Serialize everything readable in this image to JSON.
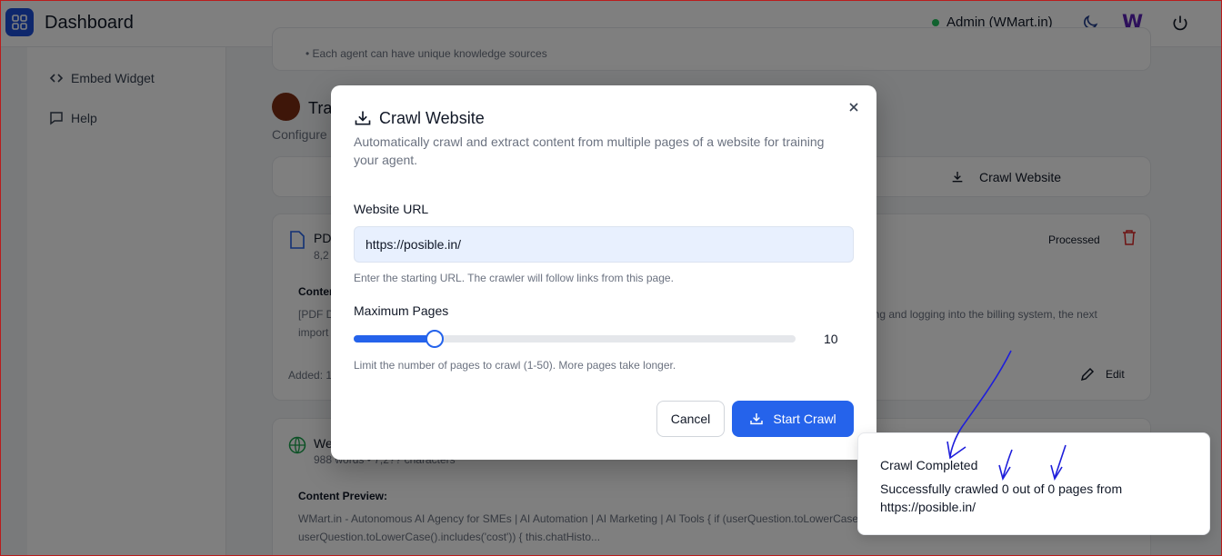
{
  "app": {
    "title": "Dashboard",
    "user": "Admin (WMart.in)",
    "brand_letter": "W"
  },
  "sidebar": {
    "items": [
      {
        "label": "Embed Widget"
      },
      {
        "label": "Help"
      }
    ]
  },
  "background": {
    "tip_text": "• Each agent can have unique knowledge sources",
    "section_title_partial": "Tra",
    "section_sub_partial": "Configure",
    "crawl_tab_label": "Crawl Website",
    "doc1": {
      "title_partial": "PD",
      "meta_partial": "8,2",
      "status": "Processed",
      "content_label_partial": "Conten",
      "preview_partial_left": "[PDF D",
      "preview_partial_left2": "import",
      "preview_right": "ing and logging into the billing system, the next",
      "added_partial": "Added: 1",
      "edit_label": "Edit"
    },
    "doc2": {
      "title_partial": "We",
      "meta_partial": "988 words • 7,2?? characters",
      "content_label": "Content Preview:",
      "preview_line1": "WMart.in - Autonomous AI Agency for SMEs | AI Automation | AI Marketing | AI Tools { if (userQuestion.toLowerCase",
      "preview_line2": "userQuestion.toLowerCase().includes('cost')) { this.chatHisto..."
    }
  },
  "modal": {
    "title": "Crawl Website",
    "description": "Automatically crawl and extract content from multiple pages of a website for training your agent.",
    "url_label": "Website URL",
    "url_value": "https://posible.in/",
    "url_hint": "Enter the starting URL. The crawler will follow links from this page.",
    "max_pages_label": "Maximum Pages",
    "max_pages_value": "10",
    "max_pages_min": 1,
    "max_pages_max": 50,
    "max_pages_hint": "Limit the number of pages to crawl (1-50). More pages take longer.",
    "cancel_label": "Cancel",
    "start_label": "Start Crawl"
  },
  "toast": {
    "title": "Crawl Completed",
    "message": "Successfully crawled 0 out of 0 pages from https://posible.in/"
  },
  "colors": {
    "primary": "#2563eb",
    "brand_purple": "#5b21b6",
    "status_green": "#22c55e",
    "annotation_ink": "#1e1edb"
  }
}
